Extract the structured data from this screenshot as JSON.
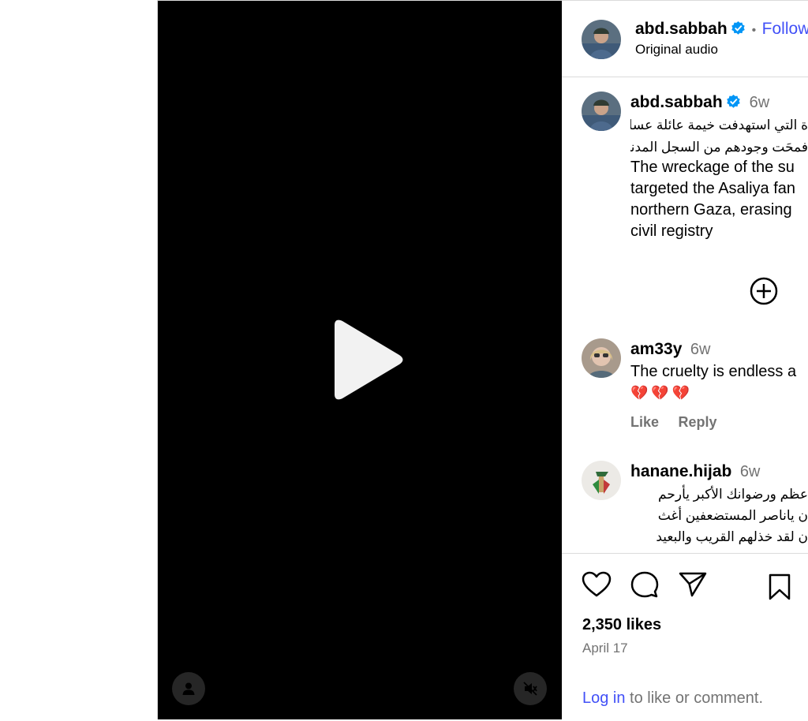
{
  "post": {
    "username": "abd.sabbah",
    "follow_label": "Follow",
    "separator": "•",
    "audio_label": "Original audio"
  },
  "caption": {
    "username": "abd.sabbah",
    "time": "6w",
    "arabic_lines": [
      "ة التي استهدفت خيمة عائلة عسلية",
      "فمحَت وجودهم من السجل المدني"
    ],
    "english_lines": [
      "The wreckage of the su",
      "targeted the Asaliya fan",
      "northern Gaza, erasing",
      "civil registry"
    ]
  },
  "comments": [
    {
      "username": "am33y",
      "time": "6w",
      "text": "The cruelty is endless a",
      "emoji": "💔💔💔",
      "like_label": "Like",
      "reply_label": "Reply"
    },
    {
      "username": "hanane.hijab",
      "time": "6w",
      "arabic_lines": [
        "عظم ورضوانك الأكبر يأرحم",
        "ن ياناصر المستضعفين أغث",
        "ن لقد خذلهم القريب والبعيد"
      ]
    }
  ],
  "actions": {
    "likes": "2,350 likes",
    "date": "April 17",
    "login_link": "Log in",
    "login_suffix": " to like or comment."
  },
  "icons": {
    "play": "play-icon",
    "profile": "user-icon",
    "mute": "speaker-muted-icon",
    "load_more": "plus-circle-icon",
    "like": "heart-icon",
    "comment": "comment-icon",
    "share": "send-icon",
    "save": "bookmark-icon",
    "verified": "verified-badge-icon"
  },
  "colors": {
    "accent": "#4150f7",
    "verified": "#0095f6",
    "muted_text": "#737373",
    "video_bg": "#000000"
  }
}
